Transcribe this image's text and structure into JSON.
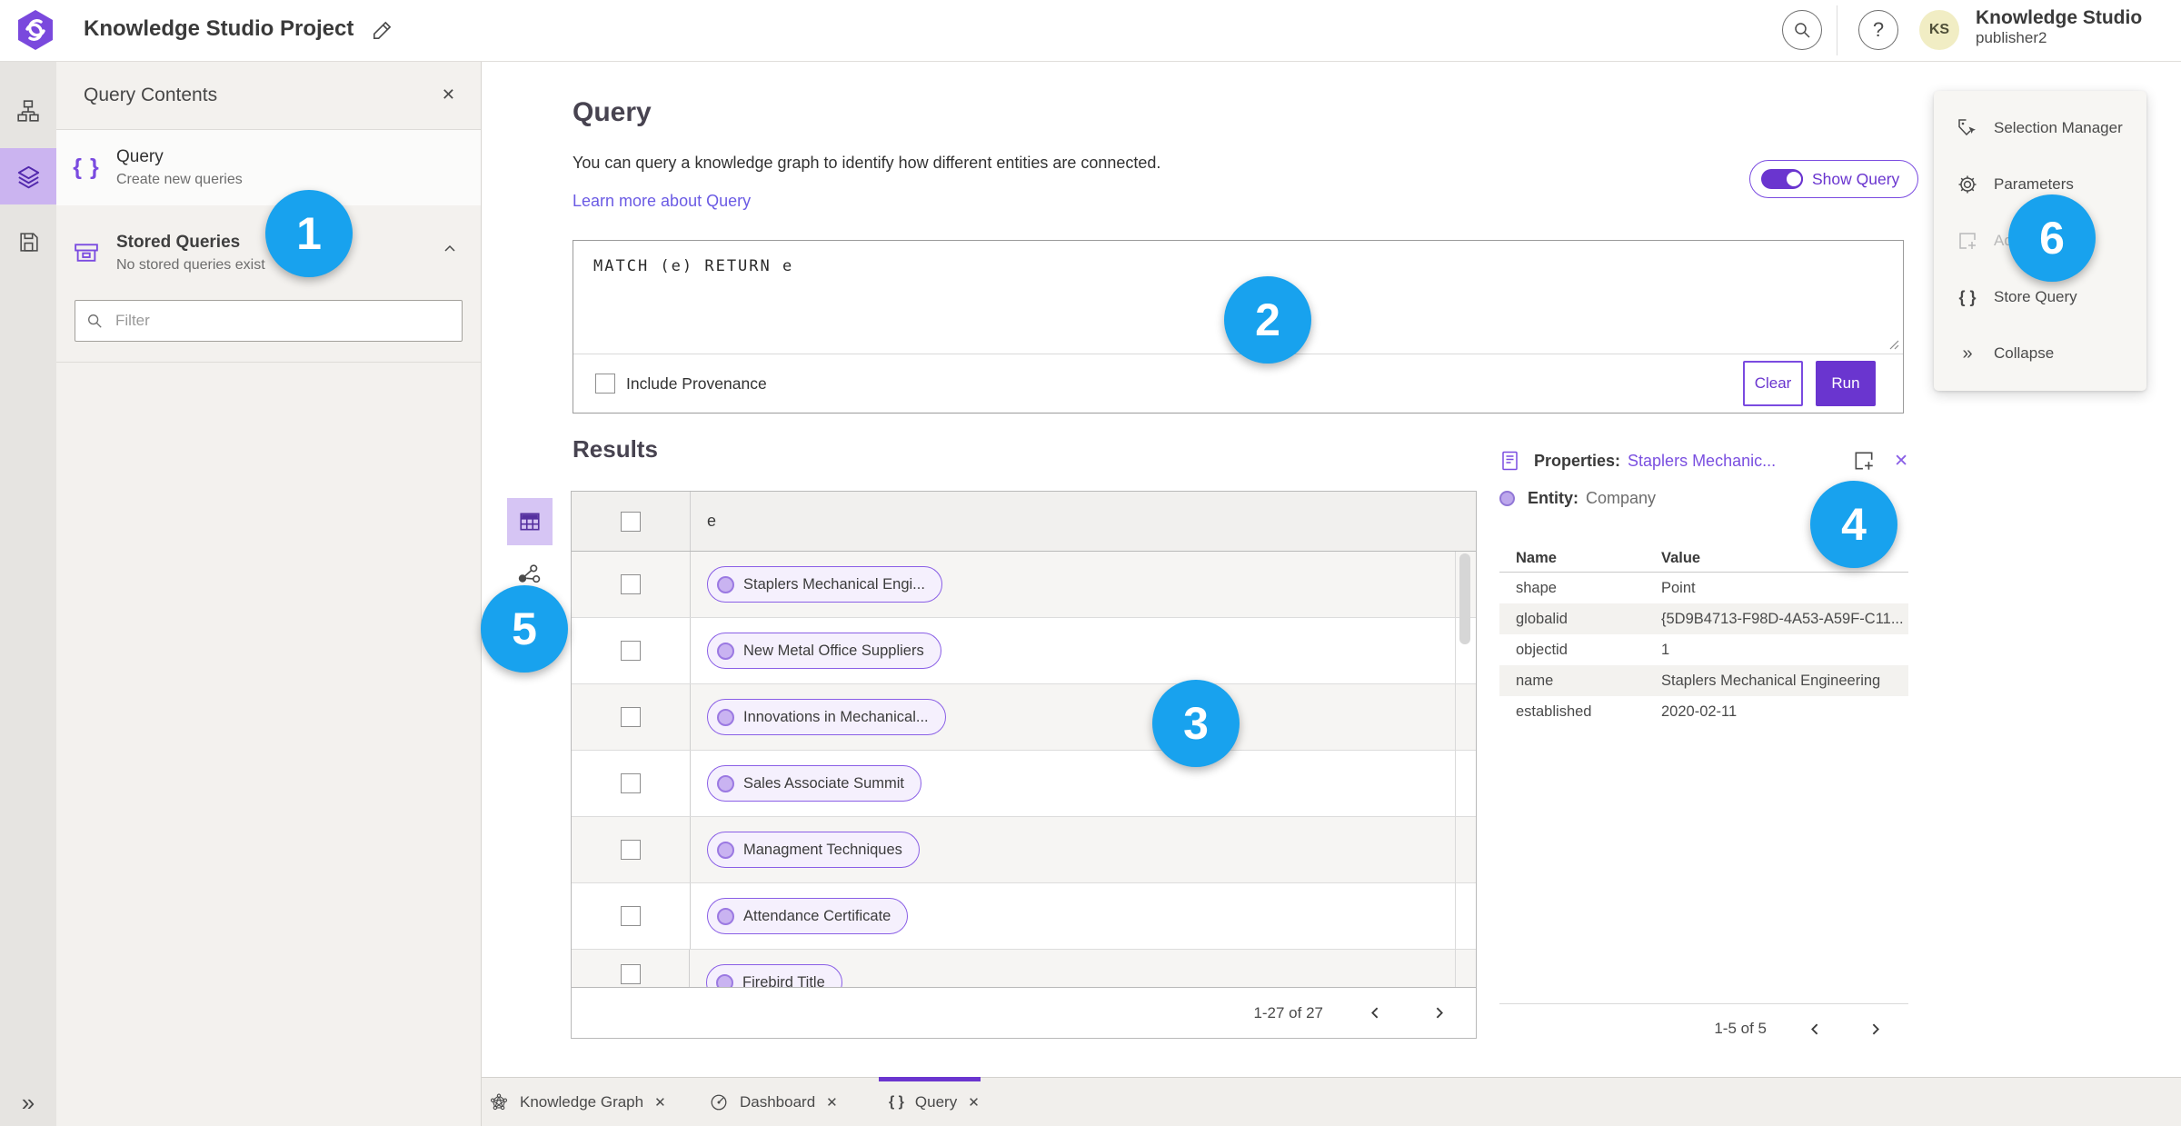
{
  "header": {
    "title": "Knowledge Studio Project",
    "user": {
      "initials": "KS",
      "name": "Knowledge Studio",
      "role": "publisher2"
    }
  },
  "contents_panel": {
    "title": "Query Contents",
    "query_item": {
      "label": "Query",
      "description": "Create new queries"
    },
    "stored_item": {
      "label": "Stored Queries",
      "description": "No stored queries exist"
    },
    "filter_placeholder": "Filter"
  },
  "query_section": {
    "title": "Query",
    "description": "You can query a knowledge graph to identify how different entities are connected.",
    "learn_more": "Learn more about Query",
    "show_query": "Show Query",
    "query_text": "MATCH (e) RETURN e",
    "include_provenance": "Include Provenance",
    "clear": "Clear",
    "run": "Run"
  },
  "results": {
    "title": "Results",
    "column": "e",
    "rows": [
      "Staplers Mechanical Engi...",
      "New Metal Office Suppliers",
      "Innovations in Mechanical...",
      "Sales Associate Summit",
      "Managment Techniques",
      "Attendance Certificate",
      "Firebird Title"
    ],
    "pagination": "1-27 of 27"
  },
  "properties": {
    "title": "Properties:",
    "selection": "Staplers Mechanic...",
    "entity_label": "Entity:",
    "entity_type": "Company",
    "col_name": "Name",
    "col_value": "Value",
    "rows": [
      [
        "shape",
        "Point"
      ],
      [
        "globalid",
        "{5D9B4713-F98D-4A53-A59F-C11..."
      ],
      [
        "objectid",
        "1"
      ],
      [
        "name",
        "Staplers Mechanical Engineering"
      ],
      [
        "established",
        "2020-02-11"
      ]
    ],
    "pagination": "1-5 of 5"
  },
  "side_menu": {
    "items": [
      "Selection Manager",
      "Parameters",
      "Add",
      "Store Query",
      "Collapse"
    ]
  },
  "tabs": [
    "Knowledge Graph",
    "Dashboard",
    "Query"
  ],
  "badges": [
    "1",
    "2",
    "3",
    "4",
    "5",
    "6"
  ],
  "colors": {
    "accent": "#6a35cf",
    "badge": "#18a2ee",
    "link": "#6b5be4",
    "pill_border": "#8a5fe6"
  }
}
